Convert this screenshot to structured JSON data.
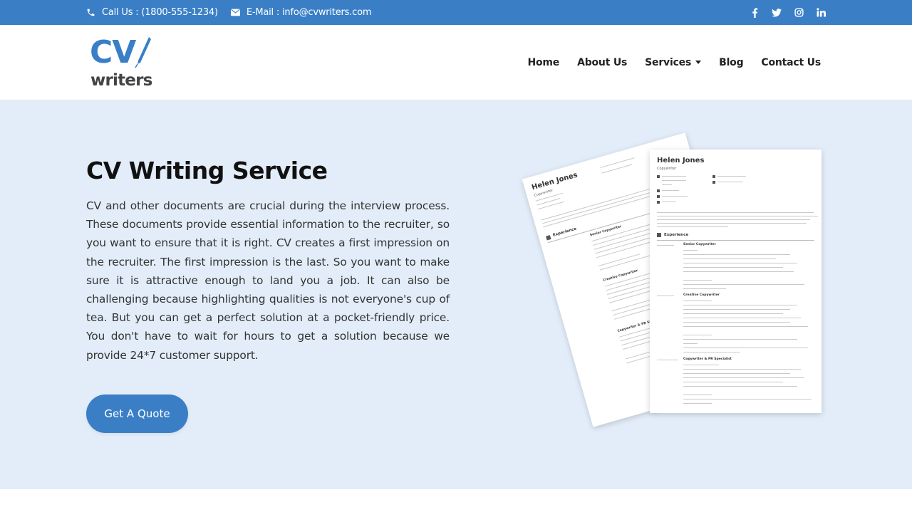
{
  "topbar": {
    "phone_label": "Call Us : (1800-555-1234)",
    "email_label": "E-Mail : info@cvwriters.com",
    "social": [
      "facebook-icon",
      "twitter-icon",
      "instagram-icon",
      "linkedin-icon"
    ]
  },
  "logo": {
    "line1": "CV",
    "line2": "writers"
  },
  "nav": {
    "home": "Home",
    "about": "About Us",
    "services": "Services",
    "blog": "Blog",
    "contact": "Contact Us"
  },
  "hero": {
    "title": "CV Writing Service",
    "body": "CV and other documents are crucial during the interview process. These documents provide essential information to the recruiter, so you want to ensure that it is right. CV creates a first impression on the recruiter. The first impression is the last. So you want to make sure it is attractive enough to land you a job. It can also be challenging because highlighting qualities is not everyone's cup of tea. But you can get a perfect solution at a pocket-friendly price. You don't have to wait for hours to get a solution because we provide 24*7 customer support.",
    "cta": "Get A Quote"
  },
  "resume": {
    "name": "Helen Jones",
    "role": "Copywriter",
    "section_experience": "Experience",
    "job1": "Senior Copywriter",
    "job2": "Creative Copywriter",
    "job3": "Copywriter & PR Specialist"
  },
  "colors": {
    "brand": "#3a7fc6",
    "hero_bg": "#e3edf9",
    "text": "#1f1f1f"
  }
}
